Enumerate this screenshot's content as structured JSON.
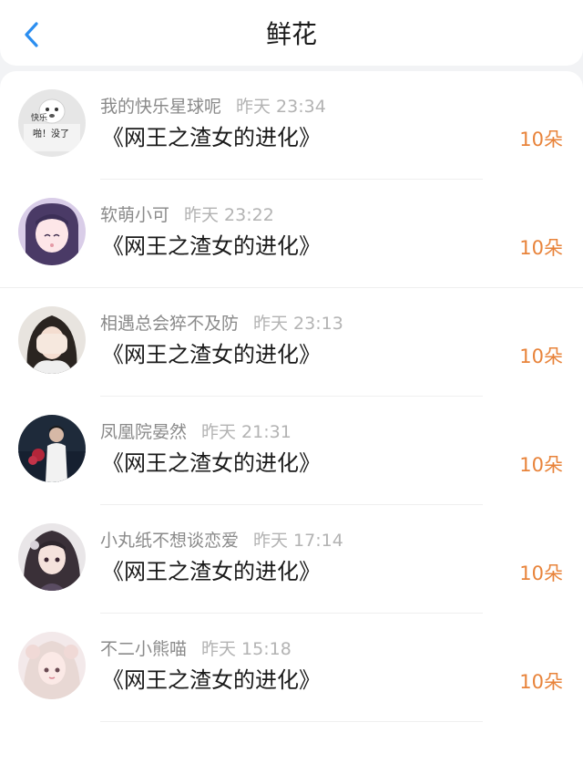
{
  "header": {
    "title": "鲜花",
    "back_icon": "chevron-left-icon",
    "accent_color": "#2b8ef0"
  },
  "flower_color": "#e8833a",
  "items": [
    {
      "user": "我的快乐星球呢",
      "time": "昨天 23:34",
      "book": "《网王之渣女的进化》",
      "flowers": "10朵",
      "avatar_text_1": "快乐",
      "avatar_text_2": "啪！没了"
    },
    {
      "user": "软萌小可",
      "time": "昨天 23:22",
      "book": "《网王之渣女的进化》",
      "flowers": "10朵"
    },
    {
      "user": "相遇总会猝不及防",
      "time": "昨天 23:13",
      "book": "《网王之渣女的进化》",
      "flowers": "10朵"
    },
    {
      "user": "凤凰院晏然",
      "time": "昨天 21:31",
      "book": "《网王之渣女的进化》",
      "flowers": "10朵"
    },
    {
      "user": "小丸纸不想谈恋爱",
      "time": "昨天 17:14",
      "book": "《网王之渣女的进化》",
      "flowers": "10朵"
    },
    {
      "user": "不二小熊喵",
      "time": "昨天 15:18",
      "book": "《网王之渣女的进化》",
      "flowers": "10朵"
    }
  ]
}
